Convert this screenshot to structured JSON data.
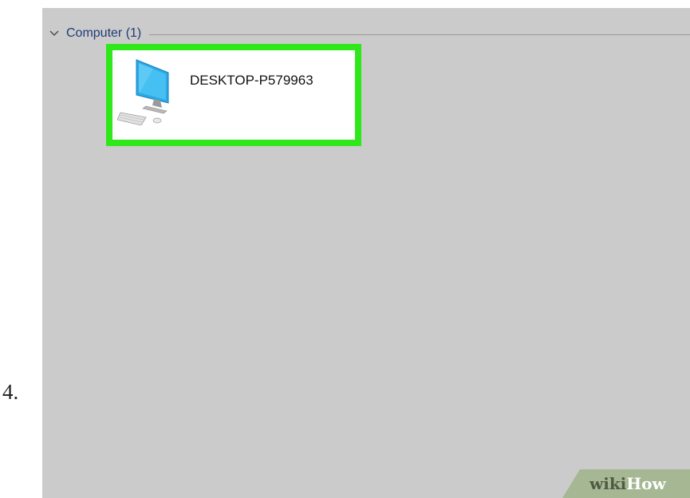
{
  "step": {
    "number": "4."
  },
  "group": {
    "label": "Computer (1)",
    "icon": "chevron-down-icon"
  },
  "items": [
    {
      "name": "DESKTOP-P579963",
      "icon": "desktop-computer-icon",
      "highlight_color": "#2ee81a"
    }
  ],
  "watermark": {
    "part1": "wiki",
    "part2": "How"
  }
}
